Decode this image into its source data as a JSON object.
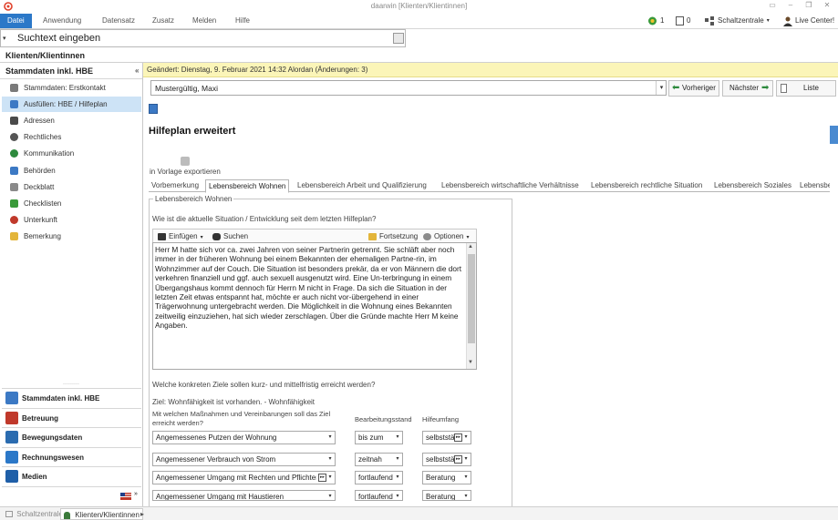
{
  "window": {
    "title": "daarwin [Klienten/Klientinnen]"
  },
  "menu": {
    "items": [
      "Datei",
      "Anwendung",
      "Datensatz",
      "Zusatz",
      "Melden",
      "Hilfe"
    ],
    "active": "Datei"
  },
  "status_indicators": {
    "count_a": "1",
    "count_b": "0",
    "center_label": "Schaltzentrale",
    "user_label": "Live Center!"
  },
  "search": {
    "value": "Suchtext eingeben"
  },
  "page": {
    "heading": "Klienten/Klientinnen"
  },
  "sidebar": {
    "header": "Stammdaten inkl. HBE",
    "collapse_glyph": "«",
    "items": [
      {
        "label": "Stammdaten: Erstkontakt",
        "icon": "wrench-icon",
        "color": "#7a7a7a"
      },
      {
        "label": "Ausfüllen: HBE / Hilfeplan",
        "icon": "form-icon",
        "color": "#3c79c4",
        "selected": true
      },
      {
        "label": "Adressen",
        "icon": "address-icon",
        "color": "#4a4a4a"
      },
      {
        "label": "Rechtliches",
        "icon": "law-icon",
        "color": "#555555"
      },
      {
        "label": "Kommunikation",
        "icon": "chat-icon",
        "color": "#2d8a3d"
      },
      {
        "label": "Behörden",
        "icon": "building-icon",
        "color": "#3c79c4"
      },
      {
        "label": "Deckblatt",
        "icon": "sheet-icon",
        "color": "#8a8a8a"
      },
      {
        "label": "Checklisten",
        "icon": "checklist-icon",
        "color": "#3a9a3a"
      },
      {
        "label": "Unterkunft",
        "icon": "house-icon",
        "color": "#c0392b"
      },
      {
        "label": "Bemerkung",
        "icon": "note-icon",
        "color": "#e3b53a"
      }
    ],
    "modules": [
      {
        "label": "Stammdaten inkl. HBE",
        "icon": "folder-icon",
        "color": "#3c79c4"
      },
      {
        "label": "Betreuung",
        "icon": "book-icon",
        "color": "#c0392b"
      },
      {
        "label": "Bewegungsdaten",
        "icon": "arrows-icon",
        "color": "#2b6cb0"
      },
      {
        "label": "Rechnungswesen",
        "icon": "invoice-icon",
        "color": "#2b78c8"
      },
      {
        "label": "Medien",
        "icon": "media-icon",
        "color": "#1f5fa8"
      }
    ]
  },
  "statusbar": {
    "tabs": [
      "Schaltzentrale",
      "Klienten/Klientinnen"
    ]
  },
  "main": {
    "change_info": "Geändert: Dienstag, 9. Februar 2021 14:32  Alordan  (Änderungen: 3)",
    "client_name": "Mustergültig, Maxi",
    "prev_label": "Vorheriger",
    "next_label": "Nächster",
    "list_label": "Liste",
    "form_title": "Hilfeplan erweitert",
    "export_label": "in Vorlage exportieren",
    "tabs": [
      "Vorbemerkung",
      "Lebensbereich Wohnen",
      "Lebensbereich Arbeit und Qualifizierung",
      "Lebensbereich wirtschaftliche Verhältnisse",
      "Lebensbereich rechtliche Situation",
      "Lebensbereich Soziales",
      "Lebensbe"
    ],
    "active_tab": "Lebensbereich Wohnen",
    "group_legend": "Lebensbereich Wohnen",
    "question1": "Wie ist die aktuelle Situation / Entwicklung seit dem letzten Hilfeplan?",
    "toolbar": {
      "insert": "Einfügen",
      "search": "Suchen",
      "continue": "Fortsetzung",
      "options": "Optionen"
    },
    "situation_text": "Herr M hatte sich vor ca. zwei Jahren von seiner Partnerin getrennt. Sie schläft aber noch immer in der früheren Wohnung  bei einem Bekannten der ehemaligen Partne-rin, im Wohnzimmer auf der Couch. Die Situation ist besonders prekär, da er von Männern die dort verkehren finanziell und ggf. auch sexuell ausgenutzt wird. Eine Un-terbringung in einem Übergangshaus kommt dennoch für Herrn M nicht in Frage. Da sich die Situation in der letzten Zeit etwas entspannt hat, möchte er auch nicht vor-übergehend in einer Trägerwohnung untergebracht werden. Die Möglichkeit in die Wohnung eines Bekannten zeitweilig einzuziehen, hat sich wieder zerschlagen. Über die Gründe machte Herr M keine Angaben.",
    "question2": "Welche konkreten Ziele sollen kurz- und mittelfristig erreicht werden?",
    "goal_line": "Ziel: Wohnfähigkeit ist vorhanden. - Wohnfähigkeit",
    "col_measures": "Mit welchen Maßnahmen und Vereinbarungen soll das Ziel erreicht werden?",
    "col_status": "Bearbeitungsstand",
    "col_scope": "Hilfeumfang",
    "rows": [
      {
        "measure": "Angemessenes Putzen der Wohnung",
        "status": "bis zum",
        "scope": "selbststä"
      },
      {
        "measure": "Angemessener Verbrauch von Strom",
        "status": "zeitnah",
        "scope": "selbststä"
      },
      {
        "measure": "Angemessener Umgang mit Rechten und Pflichten ei",
        "status": "fortlaufend",
        "scope": "Beratung"
      },
      {
        "measure": "Angemessener Umgang mit Haustieren",
        "status": "fortlaufend",
        "scope": "Beratung"
      }
    ]
  }
}
